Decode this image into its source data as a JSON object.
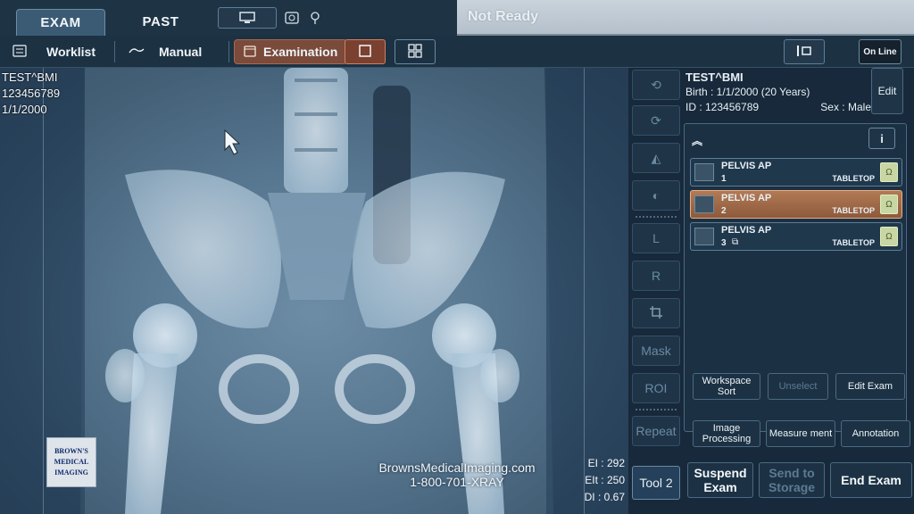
{
  "header": {
    "tabs": [
      {
        "label": "EXAM",
        "active": true
      },
      {
        "label": "PAST",
        "active": false
      }
    ],
    "status": "Not Ready"
  },
  "toolbar": {
    "worklist_label": "Worklist",
    "manual_label": "Manual",
    "examination_label": "Examination",
    "online_label": "On Line"
  },
  "viewport": {
    "overlay": {
      "name": "TEST^BMI",
      "id": "123456789",
      "dob": "1/1/2000"
    },
    "watermark_site": "BrownsMedicalImaging.com",
    "watermark_phone": "1-800-701-XRAY",
    "logo_lines": [
      "BROWN'S",
      "MEDICAL",
      "IMAGING"
    ],
    "dose": {
      "ei": "EI : 292",
      "eit": "EIt : 250",
      "di": "DI : 0.67"
    }
  },
  "tools": {
    "left_marker": "L",
    "right_marker": "R",
    "mask": "Mask",
    "roi": "ROI",
    "repeat": "Repeat",
    "tool2": "Tool 2"
  },
  "patient": {
    "name": "TEST^BMI",
    "birth": "Birth : 1/1/2000 (20 Years)",
    "id": "ID : 123456789",
    "sex": "Sex : Male",
    "edit_label": "Edit"
  },
  "series": {
    "info_label": "i",
    "items": [
      {
        "name": "PELVIS AP",
        "number": "1",
        "position": "TABLETOP",
        "selected": false
      },
      {
        "name": "PELVIS AP",
        "number": "2",
        "position": "TABLETOP",
        "selected": true
      },
      {
        "name": "PELVIS AP",
        "number": "3",
        "position": "TABLETOP",
        "selected": false
      }
    ]
  },
  "actions": {
    "workspace_sort": "Workspace Sort",
    "unselect": "Unselect",
    "edit_exam": "Edit Exam",
    "image_processing": "Image Processing",
    "measurement": "Measure ment",
    "annotation": "Annotation",
    "suspend_exam": "Suspend Exam",
    "send_to_storage": "Send to Storage",
    "end_exam": "End Exam"
  },
  "colors": {
    "selected_series": "#a86c49",
    "status_bar": "#c3ced8",
    "badge": "#c7d6a2"
  }
}
